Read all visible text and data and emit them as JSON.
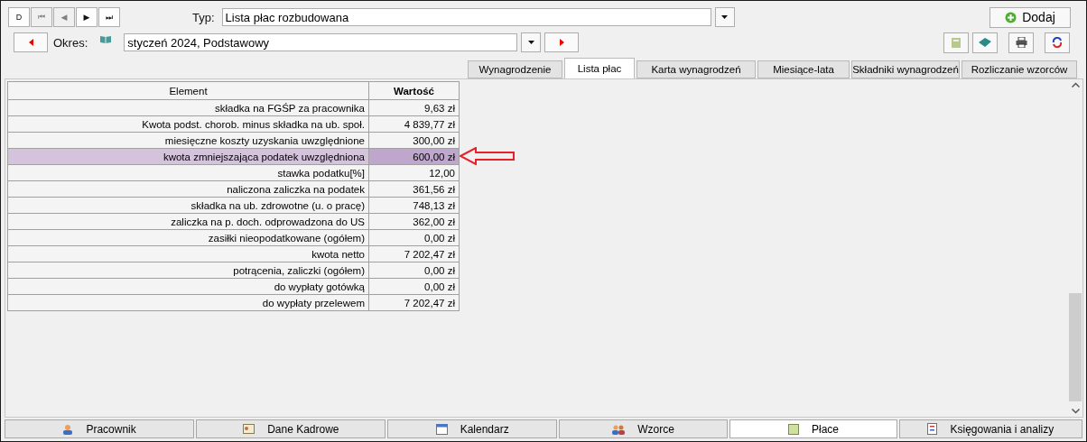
{
  "navigation": [
    {
      "label": "D",
      "disabled": false
    },
    {
      "label": "⏮",
      "disabled": true
    },
    {
      "label": "◀",
      "disabled": true
    },
    {
      "label": "▶",
      "disabled": false
    },
    {
      "label": "⏭",
      "disabled": false
    }
  ],
  "type_field": {
    "label": "Typ:",
    "value": "Lista płac rozbudowana"
  },
  "add_button": {
    "label": "Dodaj"
  },
  "period_field": {
    "label": "Okres:",
    "value": "styczeń 2024, Podstawowy"
  },
  "tabs": [
    {
      "label": "Wynagrodzenie",
      "selected": false
    },
    {
      "label": "Lista płac",
      "selected": true
    },
    {
      "label": "Karta wynagrodzeń",
      "selected": false
    },
    {
      "label": "Miesiące-lata",
      "selected": false
    },
    {
      "label": "Składniki wynagrodzeń",
      "selected": false
    },
    {
      "label": "Rozliczanie wzorców",
      "selected": false
    }
  ],
  "table": {
    "columns": [
      "Element",
      "Wartość"
    ],
    "rows": [
      {
        "element": "składka na FGŚP za pracownika",
        "value": "9,63 zł",
        "selected": false
      },
      {
        "element": "Kwota podst. chorob. minus składka na ub. społ.",
        "value": "4 839,77 zł",
        "selected": false
      },
      {
        "element": "miesięczne koszty uzyskania uwzględnione",
        "value": "300,00 zł",
        "selected": false
      },
      {
        "element": "kwota zmniejszająca podatek uwzględniona",
        "value": "600,00 zł",
        "selected": true
      },
      {
        "element": "stawka podatku[%]",
        "value": "12,00",
        "selected": false
      },
      {
        "element": "naliczona zaliczka na podatek",
        "value": "361,56 zł",
        "selected": false
      },
      {
        "element": "składka na ub. zdrowotne (u. o pracę)",
        "value": "748,13 zł",
        "selected": false
      },
      {
        "element": "zaliczka na p. doch. odprowadzona do US",
        "value": "362,00 zł",
        "selected": false
      },
      {
        "element": "zasiłki nieopodatkowane (ogółem)",
        "value": "0,00 zł",
        "selected": false
      },
      {
        "element": "kwota netto",
        "value": "7 202,47 zł",
        "selected": false
      },
      {
        "element": "potrącenia, zaliczki (ogółem)",
        "value": "0,00 zł",
        "selected": false
      },
      {
        "element": "do wypłaty gotówką",
        "value": "0,00 zł",
        "selected": false
      },
      {
        "element": "do wypłaty przelewem",
        "value": "7 202,47 zł",
        "selected": false
      }
    ]
  },
  "bottom_tabs": [
    {
      "label": "Pracownik",
      "kind": "person",
      "selected": false
    },
    {
      "label": "Dane Kadrowe",
      "kind": "card",
      "selected": false
    },
    {
      "label": "Kalendarz",
      "kind": "calendar",
      "selected": false
    },
    {
      "label": "Wzorce",
      "kind": "people",
      "selected": false
    },
    {
      "label": "Płace",
      "kind": "ledger",
      "selected": true
    },
    {
      "label": "Księgowania i analizy",
      "kind": "report",
      "selected": false
    }
  ]
}
